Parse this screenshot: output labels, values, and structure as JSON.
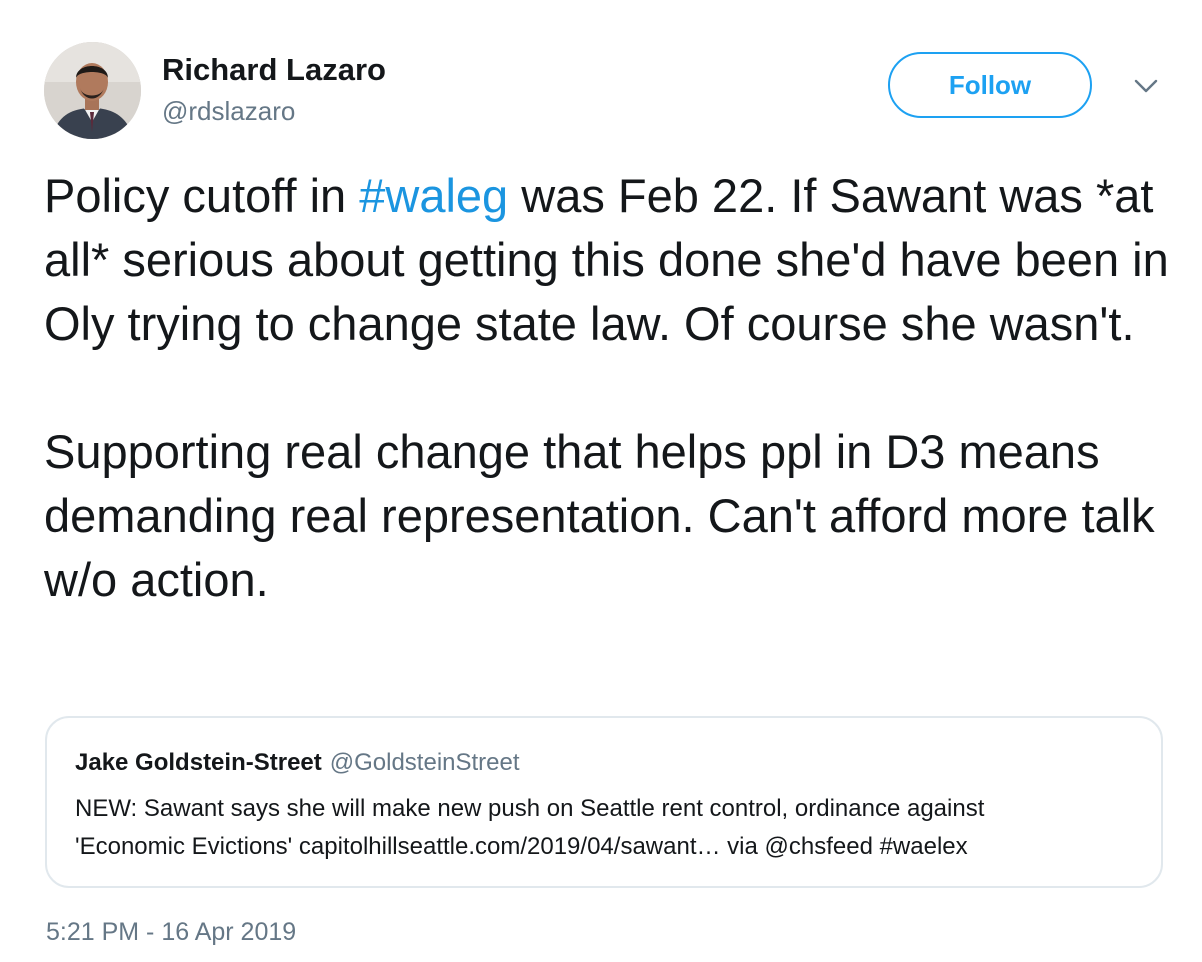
{
  "author": {
    "name": "Richard Lazaro",
    "handle": "@rdslazaro"
  },
  "follow_button": {
    "label": "Follow"
  },
  "tweet": {
    "text_part1": "Policy cutoff in ",
    "hashtag": "#waleg",
    "text_part2": " was Feb 22. If Sawant was *at all* serious about getting this done she'd have been in Oly trying to change state law. Of course she wasn't.\n\nSupporting real change that helps ppl in D3 means demanding real representation. Can't afford more talk w/o action."
  },
  "quoted_tweet": {
    "name": "Jake Goldstein-Street",
    "handle": "@GoldsteinStreet",
    "text": "NEW: Sawant says she will make new push on Seattle rent control, ordinance against\n'Economic Evictions' capitolhillseattle.com/2019/04/sawant… via @chsfeed #waelex"
  },
  "timestamp": "5:21 PM - 16 Apr 2019",
  "icons": {
    "caret": "chevron-down-icon",
    "avatar": "avatar"
  },
  "colors": {
    "accent": "#1da1f2",
    "link": "#1b95e0",
    "text": "#14171a",
    "secondary_text": "#657786",
    "border": "#e1e8ed"
  }
}
